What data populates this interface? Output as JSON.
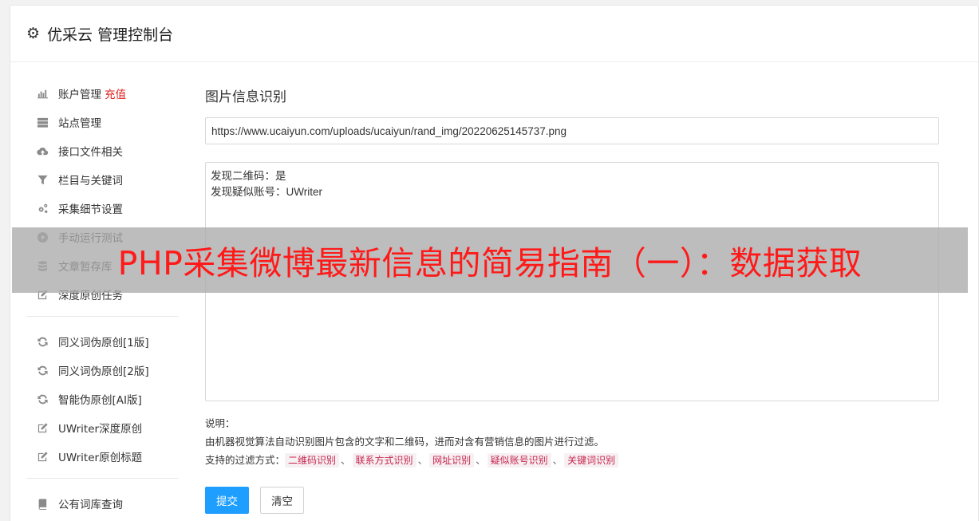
{
  "header": {
    "icon": "gear-icon",
    "title": "优采云 管理控制台"
  },
  "sidebar": {
    "groups": [
      [
        {
          "icon": "bar-chart-icon",
          "label": "账户管理",
          "extra": "充值"
        },
        {
          "icon": "server-icon",
          "label": "站点管理"
        },
        {
          "icon": "cloud-upload-icon",
          "label": "接口文件相关"
        },
        {
          "icon": "filter-icon",
          "label": "栏目与关键词"
        },
        {
          "icon": "cogs-icon",
          "label": "采集细节设置"
        },
        {
          "icon": "play-circle-icon",
          "label": "手动运行测试"
        },
        {
          "icon": "database-icon",
          "label": "文章暂存库"
        },
        {
          "icon": "edit-icon",
          "label": "深度原创任务"
        }
      ],
      [
        {
          "icon": "refresh-icon",
          "label": "同义词伪原创[1版]"
        },
        {
          "icon": "refresh-icon",
          "label": "同义词伪原创[2版]"
        },
        {
          "icon": "refresh-icon",
          "label": "智能伪原创[AI版]"
        },
        {
          "icon": "edit-icon",
          "label": "UWriter深度原创"
        },
        {
          "icon": "edit-icon",
          "label": "UWriter原创标题"
        }
      ],
      [
        {
          "icon": "book-icon",
          "label": "公有词库查询"
        }
      ]
    ]
  },
  "main": {
    "title": "图片信息识别",
    "url_value": "https://www.ucaiyun.com/uploads/ucaiyun/rand_img/20220625145737.png",
    "result_text": "发现二维码：是\n发现疑似账号：UWriter",
    "notes_heading": "说明：",
    "notes_desc": "由机器视觉算法自动识别图片包含的文字和二维码，进而对含有营销信息的图片进行过滤。",
    "filters_label": "支持的过滤方式：",
    "filters": [
      "二维码识别",
      "联系方式识别",
      "网址识别",
      "疑似账号识别",
      "关键词识别"
    ],
    "filter_separator": "、",
    "submit_label": "提交",
    "clear_label": "清空"
  },
  "overlay": {
    "text": "PHP采集微博最新信息的简易指南（一）：数据获取"
  },
  "colors": {
    "primary": "#1e9fff",
    "recharge": "#e02020",
    "tag_text": "#c7254e",
    "tag_bg": "#f7f0f2",
    "overlay_text": "#ff1a1a"
  }
}
